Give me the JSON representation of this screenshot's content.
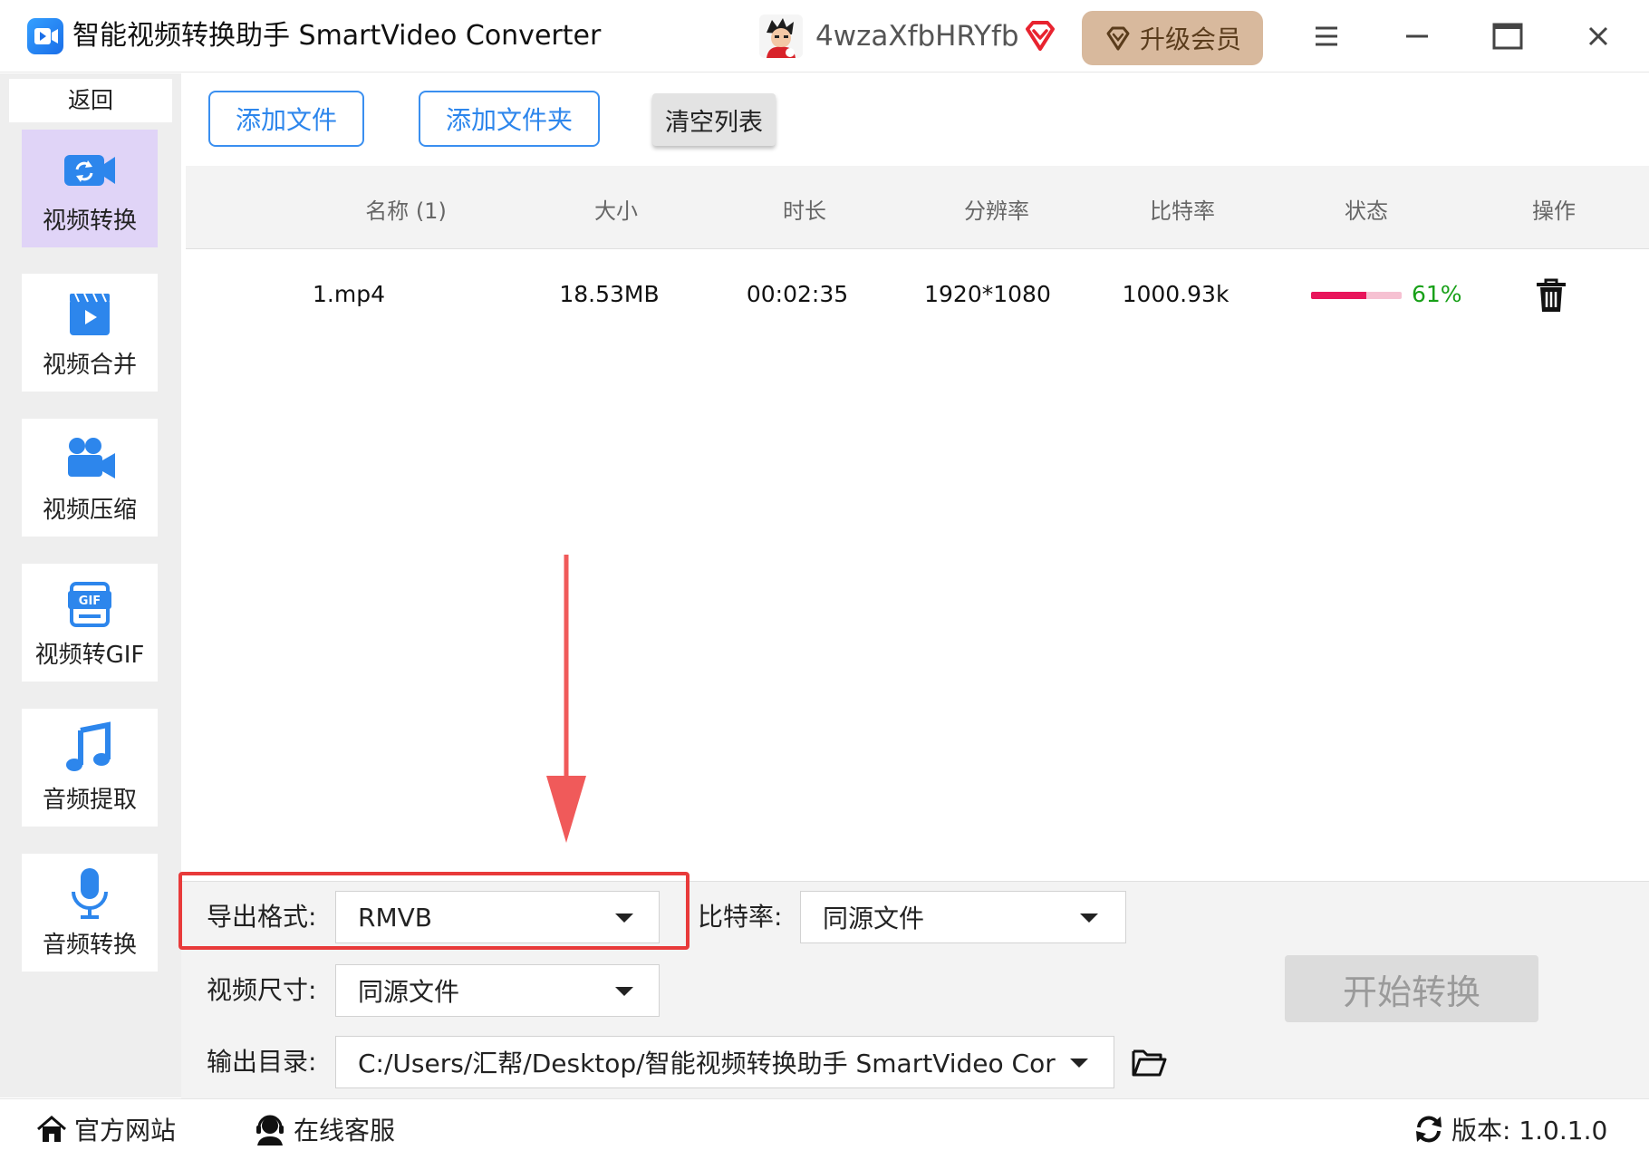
{
  "window": {
    "title": "智能视频转换助手 SmartVideo Converter",
    "username": "4wzaXfbHRYfb",
    "upgrade_label": "升级会员"
  },
  "sidebar": {
    "back_label": "返回",
    "items": [
      {
        "label": "视频转换",
        "icon": "video-convert-icon",
        "active": true
      },
      {
        "label": "视频合并",
        "icon": "video-merge-icon",
        "active": false
      },
      {
        "label": "视频压缩",
        "icon": "video-compress-icon",
        "active": false
      },
      {
        "label": "视频转GIF",
        "icon": "gif-icon",
        "active": false
      },
      {
        "label": "音频提取",
        "icon": "music-note-icon",
        "active": false
      },
      {
        "label": "音频转换",
        "icon": "microphone-icon",
        "active": false
      }
    ]
  },
  "toolbar": {
    "add_file": "添加文件",
    "add_folder": "添加文件夹",
    "clear_list": "清空列表"
  },
  "table": {
    "columns": [
      "名称 (1)",
      "大小",
      "时长",
      "分辨率",
      "比特率",
      "状态",
      "操作"
    ],
    "rows": [
      {
        "name": "1.mp4",
        "size": "18.53MB",
        "duration": "00:02:35",
        "resolution": "1920*1080",
        "bitrate": "1000.93k",
        "progress": 0.61,
        "progress_text": "61%",
        "action_icon": "trash-icon"
      }
    ]
  },
  "settings": {
    "format_label": "导出格式:",
    "format_value": "RMVB",
    "bitrate_label": "比特率:",
    "bitrate_value": "同源文件",
    "size_label": "视频尺寸:",
    "size_value": "同源文件",
    "output_label": "输出目录:",
    "output_value": "C:/Users/汇帮/Desktop/智能视频转换助手 SmartVideo Cor",
    "start_label": "开始转换"
  },
  "footer": {
    "website": "官方网站",
    "support": "在线客服",
    "version": "版本: 1.0.1.0"
  },
  "colors": {
    "accent": "#2d86ec",
    "active_nav": "#e0d4f7",
    "highlight": "#e83a3a",
    "progress": "#e8155b",
    "progress_text": "#18a018",
    "upgrade_bg": "#d8b99d"
  }
}
